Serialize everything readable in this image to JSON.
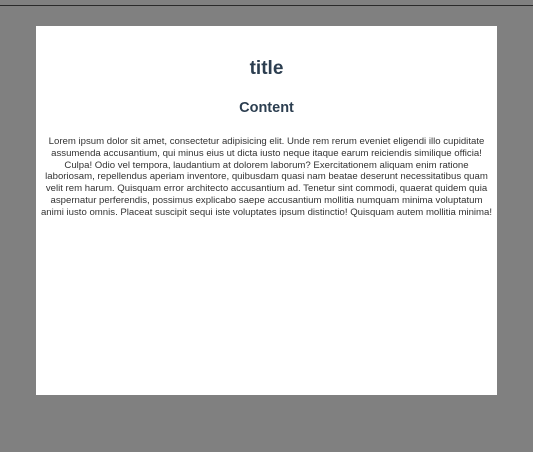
{
  "page": {
    "title": "title",
    "heading": "Content",
    "body": "Lorem ipsum dolor sit amet, consectetur adipisicing elit. Unde rem rerum eveniet eligendi illo cupiditate assumenda accusantium, qui minus eius ut dicta iusto neque itaque earum reiciendis similique officia! Culpa! Odio vel tempora, laudantium at dolorem laborum? Exercitationem aliquam enim ratione laboriosam, repellendus aperiam inventore, quibusdam quasi nam beatae deserunt necessitatibus quam velit rem harum. Quisquam error architecto accusantium ad. Tenetur sint commodi, quaerat quidem quia aspernatur perferendis, possimus explicabo saepe accusantium mollitia numquam minima voluptatum animi iusto omnis. Placeat suscipit sequi iste voluptates ipsum distinctio! Quisquam autem mollitia minima!"
  },
  "colors": {
    "backdrop": "#808080",
    "card": "#ffffff",
    "heading": "#2c3e50"
  }
}
